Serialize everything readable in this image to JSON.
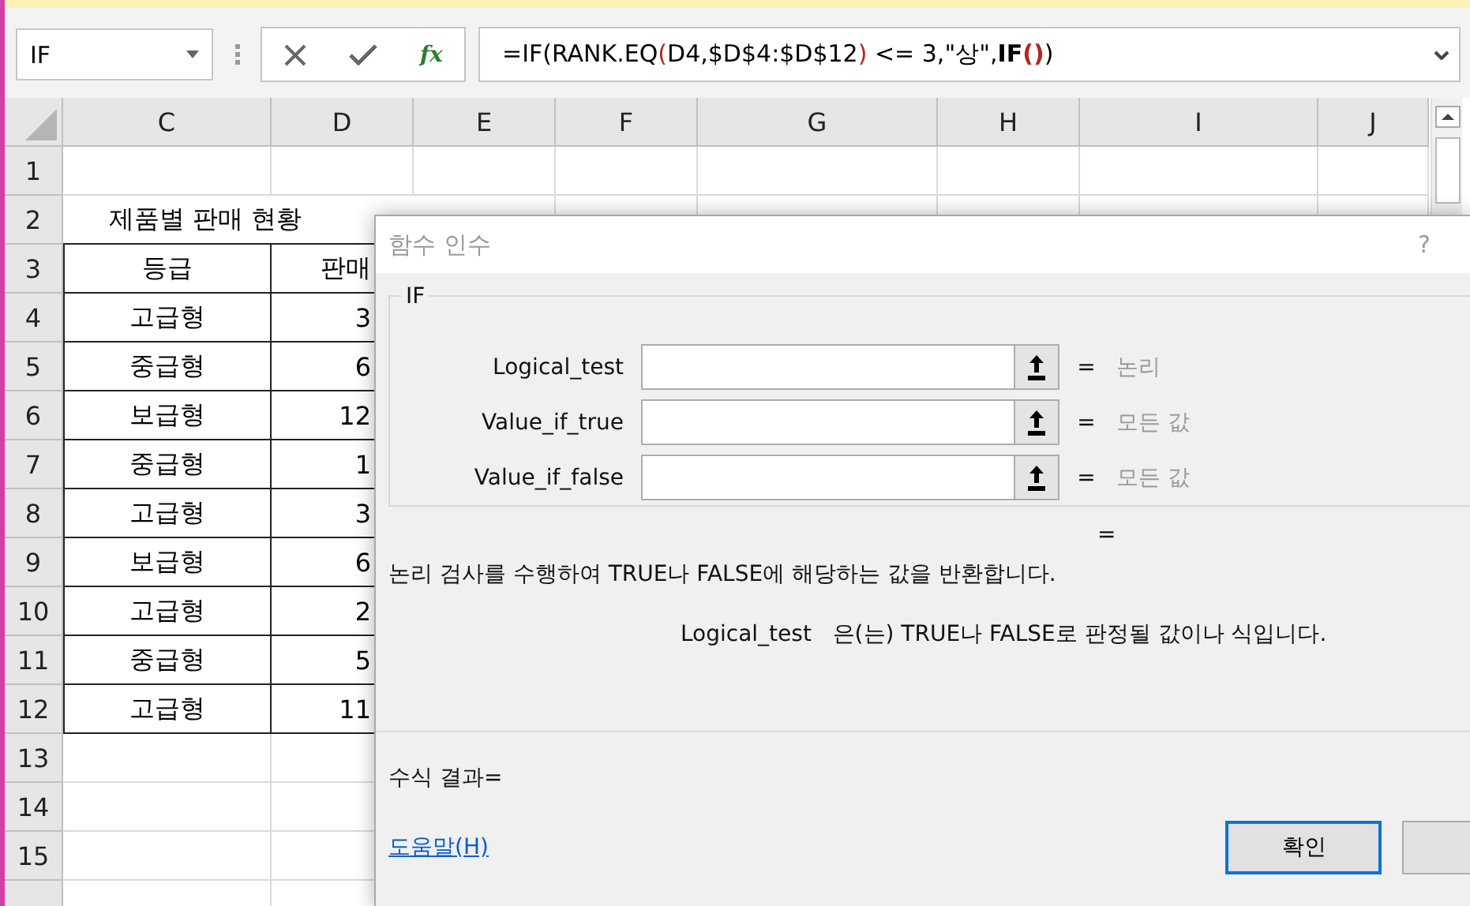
{
  "name_box": {
    "value": "IF"
  },
  "formula_bar": {
    "fx": "fx",
    "segments": [
      {
        "kind": "plain",
        "text": "=IF(RANK.EQ"
      },
      {
        "kind": "paren",
        "text": "("
      },
      {
        "kind": "plain",
        "text": "D4,$D$4:$D$12"
      },
      {
        "kind": "paren",
        "text": ")"
      },
      {
        "kind": "plain",
        "text": " <= 3,\"상\","
      },
      {
        "kind": "func",
        "text": "IF"
      },
      {
        "kind": "paren_bold",
        "text": "()"
      },
      {
        "kind": "plain",
        "text": ")"
      }
    ]
  },
  "sheet": {
    "columns": [
      "C",
      "D",
      "E",
      "F",
      "G",
      "H",
      "I",
      "J"
    ],
    "rows": [
      {
        "header": "1",
        "kind": "blank",
        "cells": []
      },
      {
        "header": "2",
        "kind": "title",
        "cells": [
          "제품별 판매 현황"
        ]
      },
      {
        "header": "3",
        "kind": "table",
        "cells": [
          "등급",
          "판매"
        ]
      },
      {
        "header": "4",
        "kind": "table",
        "cells": [
          "고급형",
          "3"
        ]
      },
      {
        "header": "5",
        "kind": "table",
        "cells": [
          "중급형",
          "6"
        ]
      },
      {
        "header": "6",
        "kind": "table",
        "cells": [
          "보급형",
          "12"
        ]
      },
      {
        "header": "7",
        "kind": "table",
        "cells": [
          "중급형",
          "1"
        ]
      },
      {
        "header": "8",
        "kind": "table",
        "cells": [
          "고급형",
          "3"
        ]
      },
      {
        "header": "9",
        "kind": "table",
        "cells": [
          "보급형",
          "6"
        ]
      },
      {
        "header": "10",
        "kind": "table",
        "cells": [
          "고급형",
          "2"
        ]
      },
      {
        "header": "11",
        "kind": "table",
        "cells": [
          "중급형",
          "5"
        ]
      },
      {
        "header": "12",
        "kind": "table",
        "cells": [
          "고급형",
          "11"
        ]
      },
      {
        "header": "13",
        "kind": "blank",
        "cells": []
      },
      {
        "header": "14",
        "kind": "blank",
        "cells": []
      },
      {
        "header": "15",
        "kind": "blank",
        "cells": []
      }
    ]
  },
  "dialog": {
    "title": "함수 인수",
    "help_mark": "?",
    "function": "IF",
    "arguments": [
      {
        "label": "Logical_test",
        "equals": "=",
        "hint": "논리"
      },
      {
        "label": "Value_if_true",
        "equals": "=",
        "hint": "모든 값"
      },
      {
        "label": "Value_if_false",
        "equals": "=",
        "hint": "모든 값"
      }
    ],
    "result_equals": "=",
    "description": "논리 검사를 수행하여 TRUE나 FALSE에 해당하는 값을 반환합니다.",
    "argument_help": {
      "name": "Logical_test",
      "text": "은(는) TRUE나 FALSE로 판정될 값이나 식입니다."
    },
    "formula_result": "수식 결과=",
    "help_link": "도움말(H)",
    "buttons": [
      {
        "label": "확인",
        "kind": "default"
      },
      {
        "kind": "cut"
      }
    ]
  }
}
